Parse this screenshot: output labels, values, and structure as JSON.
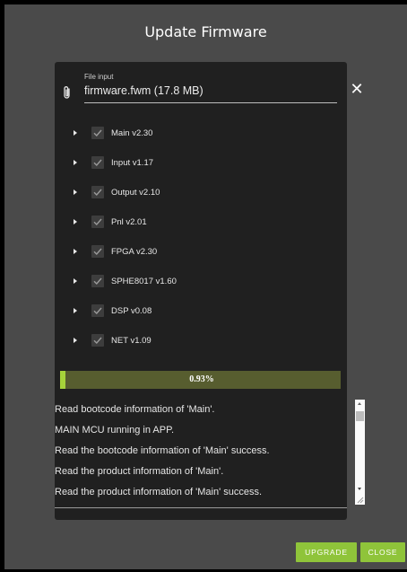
{
  "dialog": {
    "title": "Update Firmware"
  },
  "file_input": {
    "label": "File input",
    "value": "firmware.fwm (17.8 MB)",
    "clear_icon": "close-icon",
    "attach_icon": "paperclip-icon"
  },
  "modules": [
    {
      "label": "Main v2.30",
      "checked": true
    },
    {
      "label": "Input v1.17",
      "checked": true
    },
    {
      "label": "Output v2.10",
      "checked": true
    },
    {
      "label": "Pnl v2.01",
      "checked": true
    },
    {
      "label": "FPGA v2.30",
      "checked": true
    },
    {
      "label": "SPHE8017 v1.60",
      "checked": true
    },
    {
      "label": "DSP v0.08",
      "checked": true
    },
    {
      "label": "NET v1.09",
      "checked": true
    }
  ],
  "progress": {
    "text": "0.93%",
    "fraction": 0.0093
  },
  "log": [
    "Read bootcode information of 'Main'.",
    "MAIN MCU running in APP.",
    "Read the bootcode information of 'Main'  success.",
    "Read the product information of 'Main'.",
    "Read the product information of 'Main'  success."
  ],
  "buttons": {
    "upgrade": "UPGRADE",
    "close": "CLOSE"
  },
  "colors": {
    "accent": "#8fc43a",
    "progress_bg": "#575d2f",
    "panel": "#202020",
    "dialog": "#4a4a4a"
  }
}
